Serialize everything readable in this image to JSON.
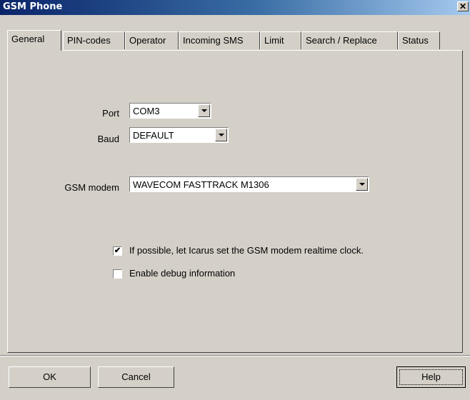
{
  "window": {
    "title": "GSM Phone"
  },
  "tabs": [
    {
      "label": "General",
      "active": true
    },
    {
      "label": "PIN-codes"
    },
    {
      "label": "Operator"
    },
    {
      "label": "Incoming SMS"
    },
    {
      "label": "Limit"
    },
    {
      "label": "Search / Replace"
    },
    {
      "label": "Status"
    }
  ],
  "general": {
    "port_label": "Port",
    "port_value": "COM3",
    "baud_label": "Baud",
    "baud_value": "DEFAULT",
    "modem_label": "GSM modem",
    "modem_value": "WAVECOM FASTTRACK M1306",
    "clock_checkbox_label": "If possible, let Icarus set the GSM modem realtime clock.",
    "clock_checked": true,
    "debug_checkbox_label": "Enable debug information",
    "debug_checked": false
  },
  "buttons": {
    "ok_label": "OK",
    "cancel_label": "Cancel",
    "help_label": "Help"
  }
}
